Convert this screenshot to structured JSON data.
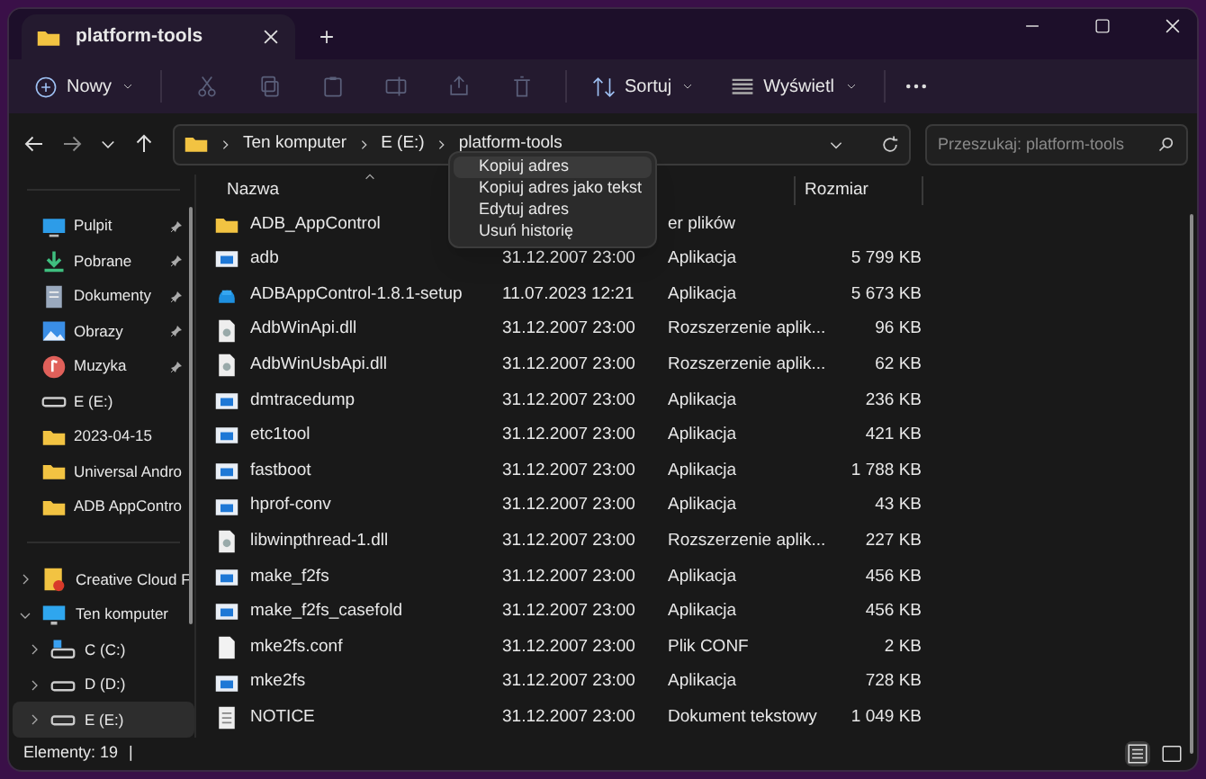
{
  "tab": {
    "title": "platform-tools"
  },
  "toolbar": {
    "new_label": "Nowy",
    "sort_label": "Sortuj",
    "view_label": "Wyświetl"
  },
  "address": {
    "crumbs": [
      "Ten komputer",
      "E (E:)",
      "platform-tools"
    ]
  },
  "search": {
    "placeholder": "Przeszukaj: platform-tools"
  },
  "sidebar": {
    "quick_access": [
      {
        "label": "Pulpit",
        "kind": "desktop",
        "pinned": true,
        "selected": false
      },
      {
        "label": "Pobrane",
        "kind": "download",
        "pinned": true,
        "selected": false
      },
      {
        "label": "Dokumenty",
        "kind": "documents",
        "pinned": true,
        "selected": false
      },
      {
        "label": "Obrazy",
        "kind": "pictures",
        "pinned": true,
        "selected": false
      },
      {
        "label": "Muzyka",
        "kind": "music",
        "pinned": true,
        "selected": false
      },
      {
        "label": "E (E:)",
        "kind": "drive",
        "pinned": false,
        "selected": false
      },
      {
        "label": "2023-04-15",
        "kind": "folder",
        "pinned": false,
        "selected": false
      },
      {
        "label": "Universal Andro",
        "kind": "folder",
        "pinned": false,
        "selected": false
      },
      {
        "label": "ADB AppContro",
        "kind": "folder",
        "pinned": false,
        "selected": false
      }
    ],
    "tree": [
      {
        "label": "Creative Cloud F",
        "kind": "cloud",
        "expanded": false,
        "selected": false
      },
      {
        "label": "Ten komputer",
        "kind": "computer",
        "expanded": true,
        "selected": false,
        "children": [
          {
            "label": "C (C:)",
            "kind": "system-drive",
            "expanded": false,
            "selected": false
          },
          {
            "label": "D (D:)",
            "kind": "drive",
            "expanded": false,
            "selected": false
          },
          {
            "label": "E (E:)",
            "kind": "drive",
            "expanded": false,
            "selected": true
          }
        ]
      }
    ]
  },
  "table": {
    "columns": [
      "Nazwa",
      "Rozmiar"
    ],
    "rows": [
      {
        "name": "ADB_AppControl",
        "kind": "folder",
        "type": "er plików"
      },
      {
        "name": "adb",
        "kind": "app",
        "date": "31.12.2007 23:00",
        "type": "Aplikacja",
        "size": "5 799 KB"
      },
      {
        "name": "ADBAppControl-1.8.1-setup",
        "kind": "setup",
        "date": "11.07.2023 12:21",
        "type": "Aplikacja",
        "size": "5 673 KB"
      },
      {
        "name": "AdbWinApi.dll",
        "kind": "dll",
        "date": "31.12.2007 23:00",
        "type": "Rozszerzenie aplik...",
        "size": "96 KB"
      },
      {
        "name": "AdbWinUsbApi.dll",
        "kind": "dll",
        "date": "31.12.2007 23:00",
        "type": "Rozszerzenie aplik...",
        "size": "62 KB"
      },
      {
        "name": "dmtracedump",
        "kind": "app",
        "date": "31.12.2007 23:00",
        "type": "Aplikacja",
        "size": "236 KB"
      },
      {
        "name": "etc1tool",
        "kind": "app",
        "date": "31.12.2007 23:00",
        "type": "Aplikacja",
        "size": "421 KB"
      },
      {
        "name": "fastboot",
        "kind": "app",
        "date": "31.12.2007 23:00",
        "type": "Aplikacja",
        "size": "1 788 KB"
      },
      {
        "name": "hprof-conv",
        "kind": "app",
        "date": "31.12.2007 23:00",
        "type": "Aplikacja",
        "size": "43 KB"
      },
      {
        "name": "libwinpthread-1.dll",
        "kind": "dll",
        "date": "31.12.2007 23:00",
        "type": "Rozszerzenie aplik...",
        "size": "227 KB"
      },
      {
        "name": "make_f2fs",
        "kind": "app",
        "date": "31.12.2007 23:00",
        "type": "Aplikacja",
        "size": "456 KB"
      },
      {
        "name": "make_f2fs_casefold",
        "kind": "app",
        "date": "31.12.2007 23:00",
        "type": "Aplikacja",
        "size": "456 KB"
      },
      {
        "name": "mke2fs.conf",
        "kind": "file",
        "date": "31.12.2007 23:00",
        "type": "Plik CONF",
        "size": "2 KB"
      },
      {
        "name": "mke2fs",
        "kind": "app",
        "date": "31.12.2007 23:00",
        "type": "Aplikacja",
        "size": "728 KB"
      },
      {
        "name": "NOTICE",
        "kind": "text",
        "date": "31.12.2007 23:00",
        "type": "Dokument tekstowy",
        "size": "1 049 KB"
      }
    ]
  },
  "context_menu": {
    "items": [
      {
        "label": "Kopiuj adres",
        "selected": true
      },
      {
        "label": "Kopiuj adres jako tekst",
        "selected": false
      },
      {
        "label": "Edytuj adres",
        "selected": false
      },
      {
        "label": "Usuń historię",
        "selected": false
      }
    ]
  },
  "status_bar": {
    "count": "Elementy: 19",
    "separator": "|"
  }
}
